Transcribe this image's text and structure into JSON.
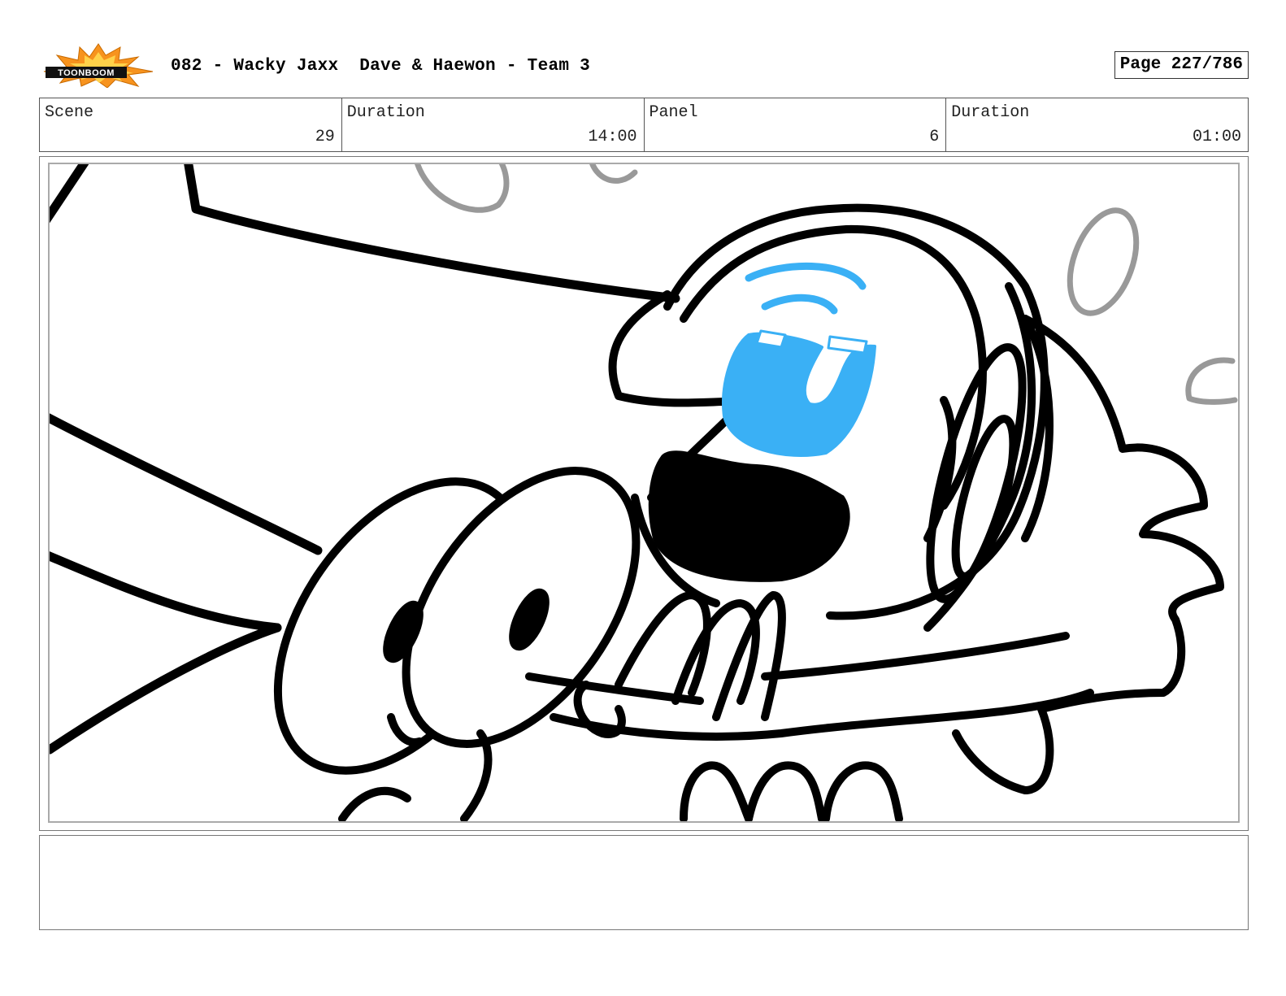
{
  "header": {
    "logo_text": "TOONBOOM",
    "title": "082 - Wacky Jaxx  Dave & Haewon - Team 3",
    "page": "Page 227/786"
  },
  "info": {
    "scene_label": "Scene",
    "scene_value": "29",
    "scene_duration_label": "Duration",
    "scene_duration_value": "14:00",
    "panel_label": "Panel",
    "panel_value": "6",
    "panel_duration_label": "Duration",
    "panel_duration_value": "01:00"
  },
  "notes": {
    "text": ""
  },
  "colors": {
    "logo_burst": "#f7931e",
    "logo_burst_inner": "#ffd24a",
    "visor_blue": "#3ab0f5",
    "sketch_line": "#000000",
    "bubble_grey": "#999999"
  }
}
